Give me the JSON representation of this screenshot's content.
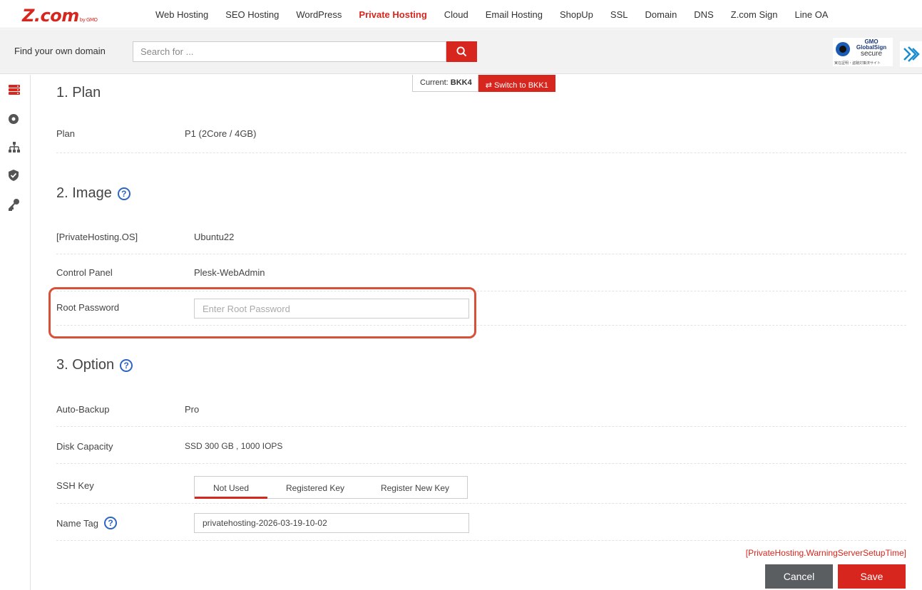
{
  "header": {
    "logo_text": "Z.com",
    "logo_sub": "by GMO",
    "nav": [
      {
        "label": "Web Hosting"
      },
      {
        "label": "SEO Hosting"
      },
      {
        "label": "WordPress"
      },
      {
        "label": "Private Hosting",
        "active": true
      },
      {
        "label": "Cloud"
      },
      {
        "label": "Email Hosting"
      },
      {
        "label": "ShopUp"
      },
      {
        "label": "SSL"
      },
      {
        "label": "Domain"
      },
      {
        "label": "DNS"
      },
      {
        "label": "Z.com Sign"
      },
      {
        "label": "Line OA"
      }
    ]
  },
  "search": {
    "label": "Find your own domain",
    "placeholder": "Search for ...",
    "badge_brand": "GMO",
    "badge_name": "GlobalSign",
    "badge_secure": "secure",
    "badge_sub": "実在証明・盗聴対策済サイト"
  },
  "datacenter": {
    "current_prefix": "Current: ",
    "current_value": "BKK4",
    "switch_label": "Switch to BKK1"
  },
  "sections": {
    "plan": {
      "title": "1. Plan",
      "plan_label": "Plan",
      "plan_value": "P1 (2Core / 4GB)"
    },
    "image": {
      "title": "2. Image",
      "os_label": "[PrivateHosting.OS]",
      "os_value": "Ubuntu22",
      "panel_label": "Control Panel",
      "panel_value": "Plesk-WebAdmin",
      "password_label": "Root Password",
      "password_placeholder": "Enter Root Password"
    },
    "option": {
      "title": "3. Option",
      "backup_label": "Auto-Backup",
      "backup_value": "Pro",
      "disk_label": "Disk Capacity",
      "disk_value": "SSD 300 GB , 1000 IOPS",
      "ssh_label": "SSH Key",
      "ssh_tabs": [
        "Not Used",
        "Registered Key",
        "Register New Key"
      ],
      "name_label": "Name Tag",
      "name_value": "privatehosting-2026-03-19-10-02"
    }
  },
  "help_glyph": "?",
  "footer": {
    "warning": "[PrivateHosting.WarningServerSetupTime]",
    "cancel_label": "Cancel",
    "save_label": "Save"
  },
  "colors": {
    "brand_red": "#d7261e",
    "help_blue": "#2d65c4",
    "highlight": "#d9503a",
    "cancel_gray": "#5a5e61"
  }
}
